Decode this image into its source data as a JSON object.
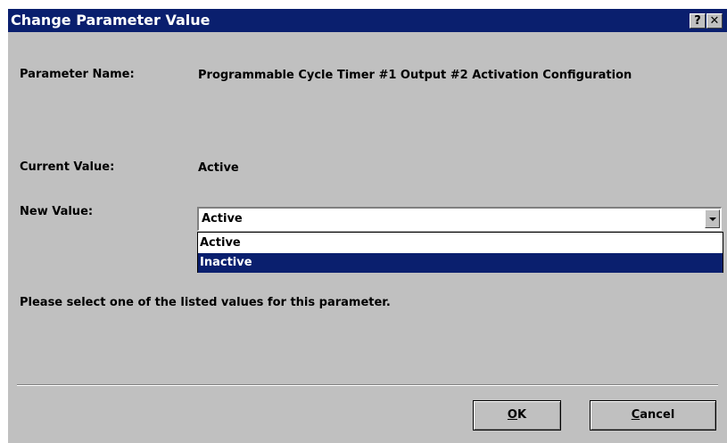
{
  "window": {
    "title": "Change Parameter Value",
    "help_button": "?",
    "close_button": "✕"
  },
  "fields": {
    "parameter_name_label": "Parameter Name:",
    "parameter_name_value": "Programmable Cycle Timer #1 Output #2 Activation Configuration",
    "current_value_label": "Current Value:",
    "current_value": "Active",
    "new_value_label": "New Value:",
    "new_value_selected": "Active",
    "options": [
      "Active",
      "Inactive"
    ],
    "highlighted_option": "Inactive"
  },
  "instruction": "Please select one of the listed values for this parameter.",
  "buttons": {
    "ok_label": "OK",
    "ok_mnemonic": "O",
    "ok_rest": "K",
    "cancel_label": "Cancel",
    "cancel_mnemonic": "C",
    "cancel_rest": "ancel"
  },
  "colors": {
    "titlebar": "#0a1f6e",
    "dialog_background": "#c0c0c0",
    "selection": "#0a1f6e"
  },
  "icons": {
    "help": "help-icon",
    "close": "close-icon",
    "dropdown": "chevron-down-icon"
  }
}
